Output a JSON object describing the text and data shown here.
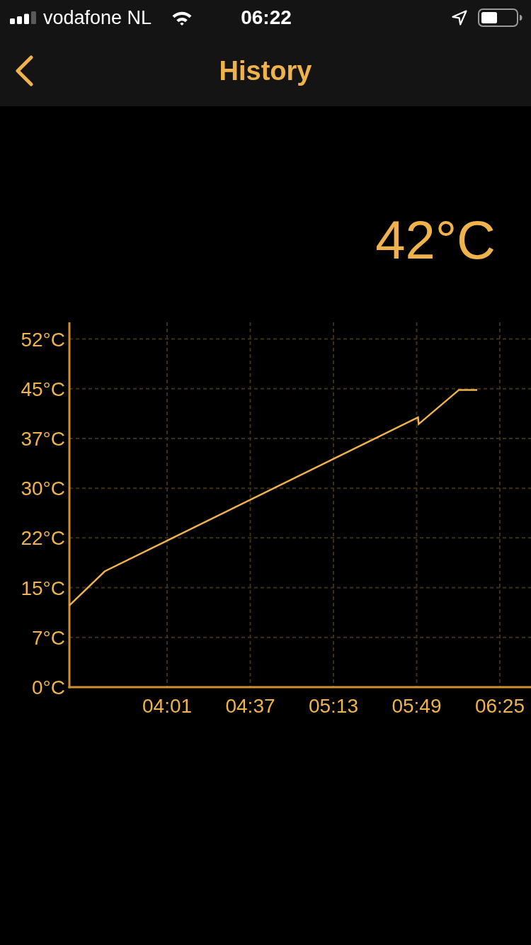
{
  "status_bar": {
    "carrier": "vodafone NL",
    "time": "06:22"
  },
  "nav_bar": {
    "title": "History"
  },
  "current_temperature": "42°C",
  "chart": {
    "chart_data": {
      "type": "line",
      "grid": true,
      "x": [
        198.7,
        214.0,
        349.6,
        349.9,
        367.3,
        375.2
      ],
      "series": [
        {
          "color": "#f0b24a",
          "values": [
            12.2,
            17.3,
            40.3,
            39.3,
            44.4,
            44.4
          ]
        }
      ],
      "xlim": [
        198.7,
        398.5
      ],
      "ylim": [
        0,
        54.5
      ],
      "xticks": [
        {
          "value": 241,
          "label": "04:01"
        },
        {
          "value": 277,
          "label": "04:37"
        },
        {
          "value": 313,
          "label": "05:13"
        },
        {
          "value": 349,
          "label": "05:49"
        },
        {
          "value": 385,
          "label": "06:25"
        }
      ],
      "yticks": [
        {
          "value": 0,
          "label": "0°C"
        },
        {
          "value": 7.43,
          "label": "7°C"
        },
        {
          "value": 14.86,
          "label": "15°C"
        },
        {
          "value": 22.29,
          "label": "22°C"
        },
        {
          "value": 29.71,
          "label": "30°C"
        },
        {
          "value": 37.14,
          "label": "37°C"
        },
        {
          "value": 44.57,
          "label": "45°C"
        },
        {
          "value": 52,
          "label": "52°C"
        }
      ]
    }
  }
}
